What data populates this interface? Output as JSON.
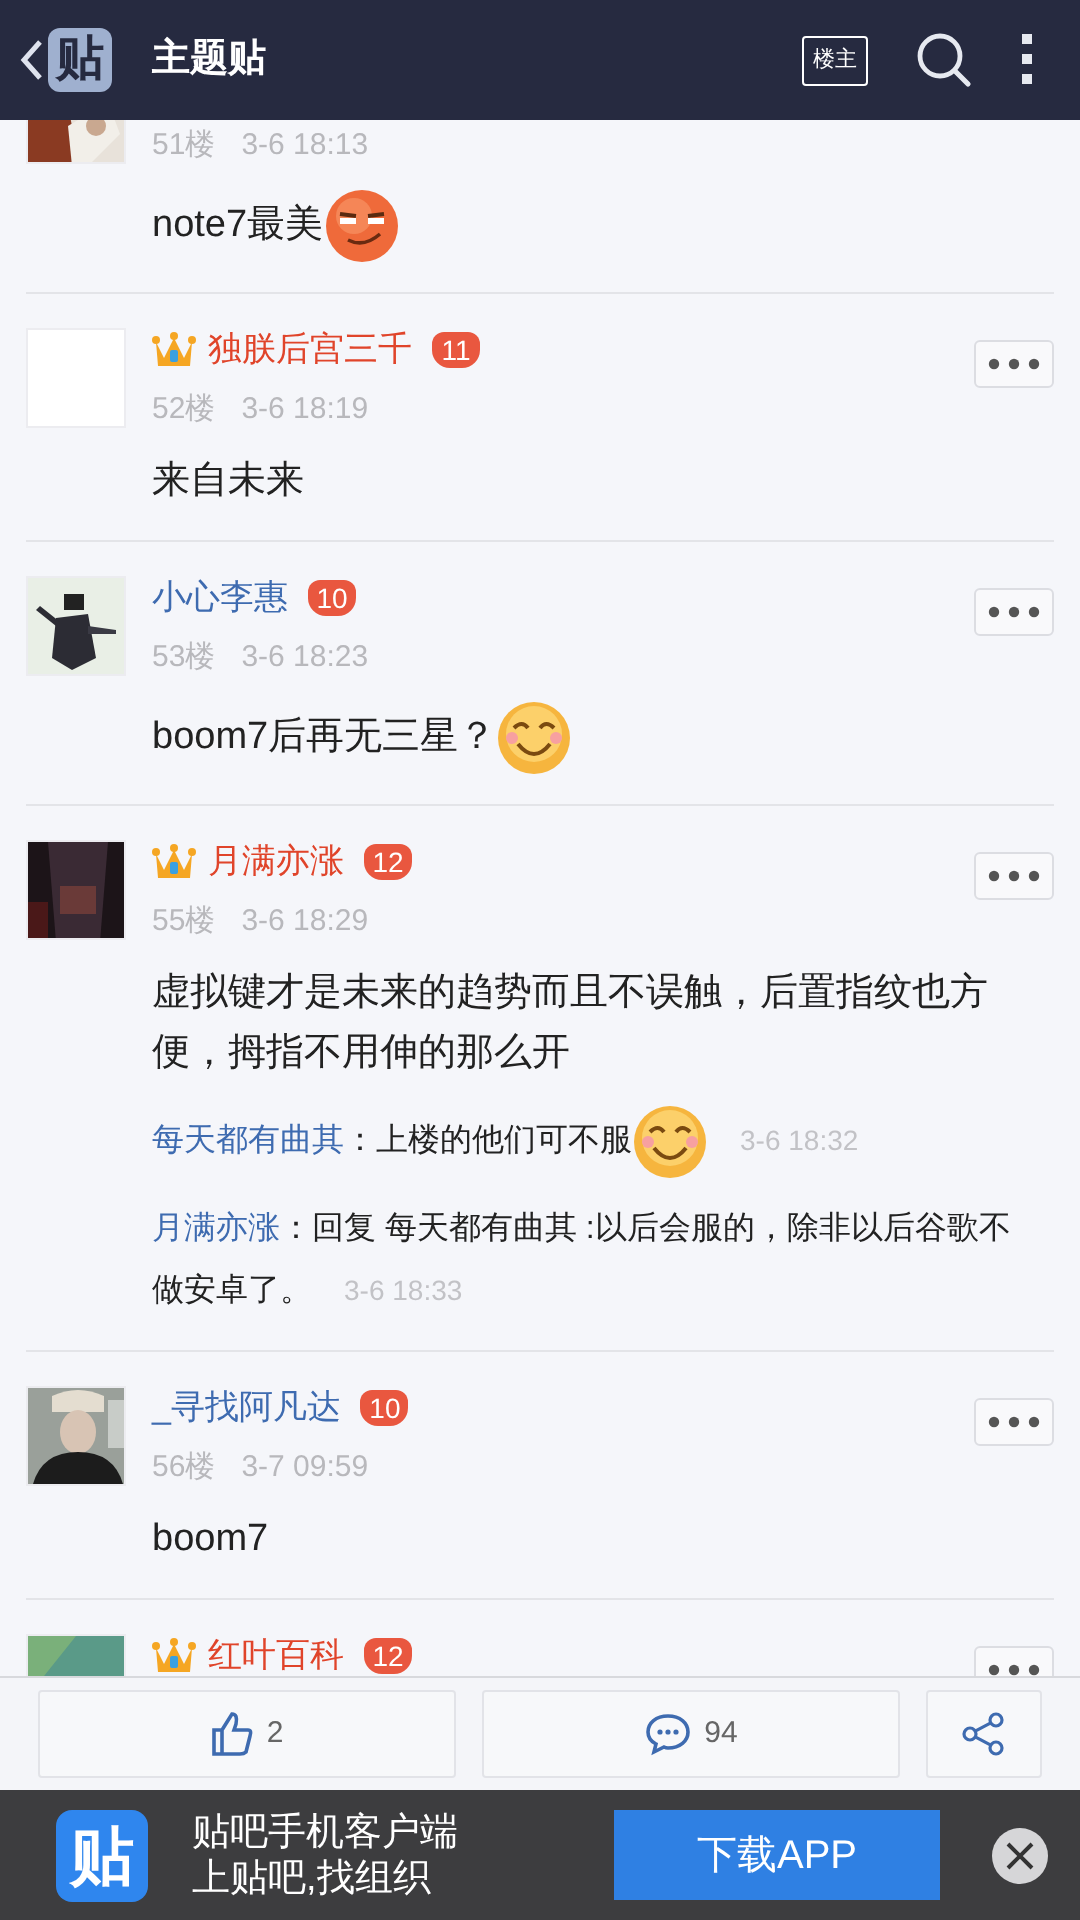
{
  "header": {
    "logo": "贴",
    "title": "主题贴",
    "owner_button": "楼主"
  },
  "posts": [
    {
      "floor": "51楼",
      "time": "3-6 18:13",
      "content": "note7最美",
      "emoji": {
        "kind": "smirk"
      }
    },
    {
      "avatar": {
        "kind": "blank"
      },
      "name": "独朕后宫三千",
      "vip": true,
      "level": "11",
      "floor": "52楼",
      "time": "3-6 18:19",
      "content": "来自未来"
    },
    {
      "name": "小心李惠",
      "vip": false,
      "level": "10",
      "floor": "53楼",
      "time": "3-6 18:23",
      "content": "boom7后再无三星？",
      "emoji": {
        "kind": "smile"
      }
    },
    {
      "name": "月满亦涨",
      "vip": true,
      "level": "12",
      "floor": "55楼",
      "time": "3-6 18:29",
      "content": "虚拟键才是未来的趋势而且不误触，后置指纹也方便，拇指不用伸的那么开",
      "replies": [
        {
          "author": "每天都有曲其",
          "text": "：上楼的他们可不服",
          "emoji": {
            "kind": "smile"
          },
          "time": "3-6 18:32"
        },
        {
          "author": "月满亦涨",
          "text": "：回复 每天都有曲其 :以后会服的，除非以后谷歌不做安卓了。",
          "time": "3-6 18:33"
        }
      ]
    },
    {
      "name": "_寻找阿凡达",
      "vip": false,
      "level": "10",
      "floor": "56楼",
      "time": "3-7 09:59",
      "content": "boom7"
    },
    {
      "name": "红叶百科",
      "vip": true,
      "level": "12"
    }
  ],
  "actions": {
    "likes": "2",
    "comments": "94"
  },
  "ad": {
    "logo": "贴",
    "line1": "贴吧手机客户端",
    "line2": "上贴吧,找组织",
    "button": "下载APP"
  }
}
